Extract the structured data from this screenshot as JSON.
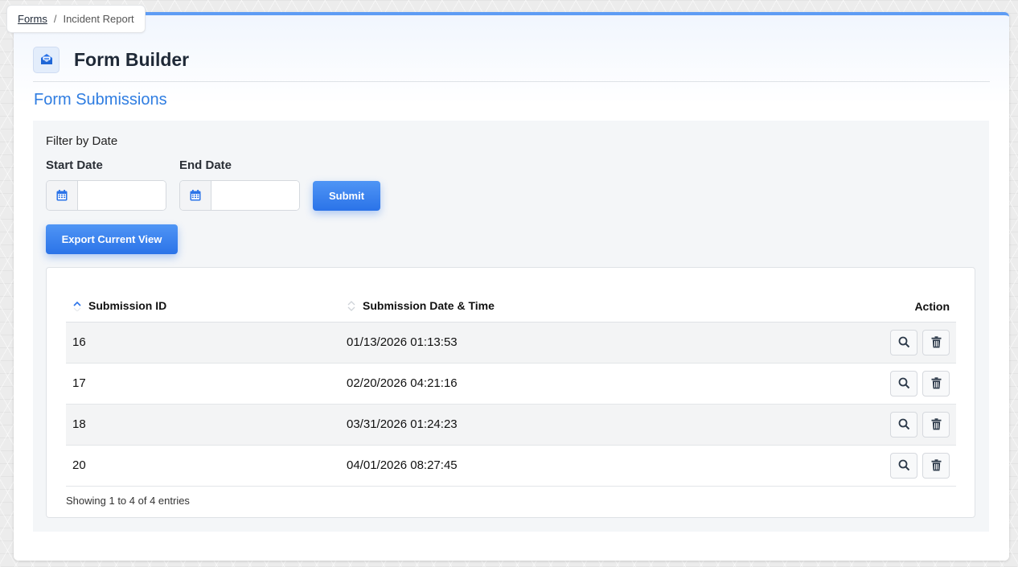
{
  "breadcrumb": {
    "root": "Forms",
    "separator": "/",
    "current": "Incident Report"
  },
  "header": {
    "title": "Form Builder",
    "logo_icon": "envelope-open-icon"
  },
  "section": {
    "title": "Form Submissions"
  },
  "filter": {
    "heading": "Filter by Date",
    "start_label": "Start Date",
    "end_label": "End Date",
    "start_value": "",
    "end_value": "",
    "submit_label": "Submit"
  },
  "export": {
    "label": "Export Current View"
  },
  "table": {
    "columns": {
      "id": "Submission ID",
      "date": "Submission Date & Time",
      "action": "Action"
    },
    "rows": [
      {
        "id": "16",
        "date": "01/13/2026 01:13:53"
      },
      {
        "id": "17",
        "date": "02/20/2026 04:21:16"
      },
      {
        "id": "18",
        "date": "03/31/2026 01:24:23"
      },
      {
        "id": "20",
        "date": "04/01/2026 08:27:45"
      }
    ],
    "info": "Showing 1 to 4 of 4 entries"
  },
  "colors": {
    "accent": "#2b73e8",
    "top_border": "#5e9cf4",
    "section_title": "#2f7de1"
  }
}
